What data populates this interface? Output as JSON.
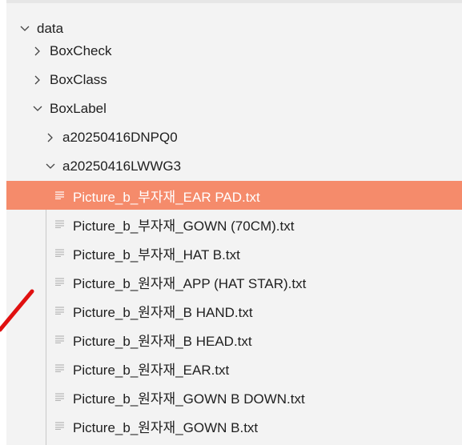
{
  "tree": {
    "root": {
      "label": "data",
      "expanded": true
    },
    "folders": [
      {
        "label": "BoxCheck",
        "expanded": false
      },
      {
        "label": "BoxClass",
        "expanded": false
      },
      {
        "label": "BoxLabel",
        "expanded": true
      }
    ],
    "boxlabel_children": [
      {
        "label": "a20250416DNPQ0",
        "expanded": false
      },
      {
        "label": "a20250416LWWG3",
        "expanded": true
      }
    ],
    "files": [
      {
        "label": "Picture_b_부자재_EAR PAD.txt",
        "selected": true
      },
      {
        "label": "Picture_b_부자재_GOWN (70CM).txt",
        "selected": false
      },
      {
        "label": "Picture_b_부자재_HAT B.txt",
        "selected": false
      },
      {
        "label": "Picture_b_원자재_APP (HAT STAR).txt",
        "selected": false
      },
      {
        "label": "Picture_b_원자재_B HAND.txt",
        "selected": false
      },
      {
        "label": "Picture_b_원자재_B HEAD.txt",
        "selected": false
      },
      {
        "label": "Picture_b_원자재_EAR.txt",
        "selected": false
      },
      {
        "label": "Picture_b_원자재_GOWN B DOWN.txt",
        "selected": false
      },
      {
        "label": "Picture_b_원자재_GOWN B.txt",
        "selected": false
      }
    ]
  },
  "icons": {
    "expanded": "chevron-down-icon",
    "collapsed": "chevron-right-icon",
    "file": "text-file-icon"
  },
  "colors": {
    "background": "#f3f3f3",
    "selection": "#f58b6b",
    "annotation": "#e01010",
    "text": "#1f1f1f"
  }
}
